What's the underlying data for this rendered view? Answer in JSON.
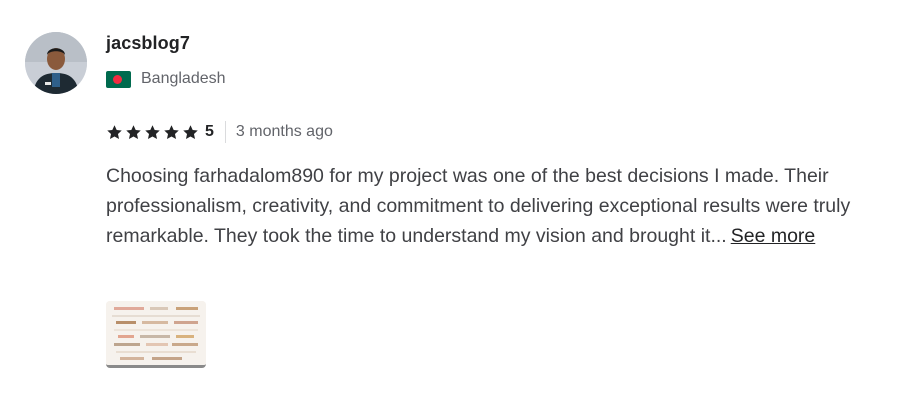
{
  "reviewer": {
    "username": "jacsblog7",
    "country": "Bangladesh",
    "avatar_icon": "user-avatar-photo",
    "flag_icon": "bangladesh-flag-icon"
  },
  "rating": {
    "value": "5",
    "stars": 5,
    "star_color": "#222325",
    "time_ago": "3 months ago"
  },
  "review": {
    "text": "Choosing farhadalom890 for my project was one of the best decisions I made. Their professionalism, creativity, and commitment to delivering exceptional results were truly remarkable. They took the time to understand my vision and brought it...",
    "see_more_label": "See more"
  },
  "attachment": {
    "thumbnail_icon": "delivery-image-thumbnail"
  },
  "colors": {
    "text_primary": "#222325",
    "text_body": "#404145",
    "text_muted": "#62646a",
    "flag_green": "#006a4e",
    "flag_red": "#f42a41"
  }
}
